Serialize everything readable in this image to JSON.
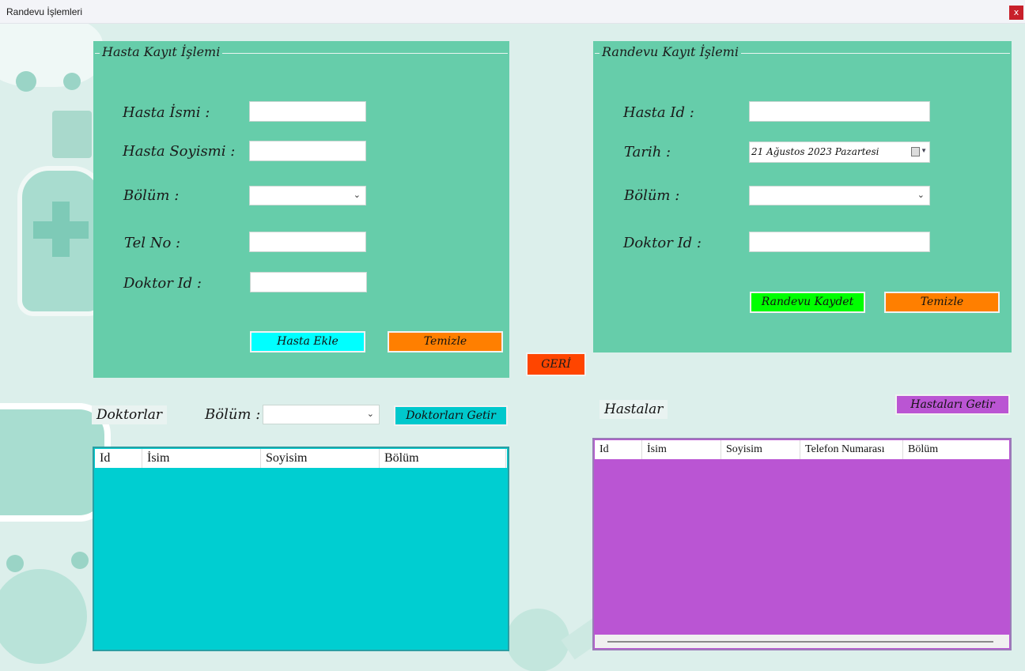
{
  "window": {
    "title": "Randevu İşlemleri",
    "close_label": "x"
  },
  "hasta_panel": {
    "title": "Hasta Kayıt İşlemi",
    "labels": {
      "isim": "Hasta İsmi :",
      "soyisim": "Hasta Soyismi :",
      "bolum": "Bölüm :",
      "tel": "Tel No :",
      "doktor": "Doktor Id :"
    },
    "values": {
      "isim": "",
      "soyisim": "",
      "bolum": "",
      "tel": "",
      "doktor": ""
    },
    "ekle_label": "Hasta Ekle",
    "temizle_label": "Temizle"
  },
  "randevu_panel": {
    "title": "Randevu Kayıt İşlemi",
    "labels": {
      "hasta_id": "Hasta Id :",
      "tarih": "Tarih :",
      "bolum": "Bölüm :",
      "doktor_id": "Doktor Id :"
    },
    "values": {
      "hasta_id": "",
      "tarih": "21 Ağustos 2023  Pazartesi",
      "bolum": "",
      "doktor_id": ""
    },
    "kaydet_label": "Randevu Kaydet",
    "temizle_label": "Temizle"
  },
  "geri_label": "GERİ",
  "doktorlar": {
    "title": "Doktorlar",
    "bolum_label": "Bölüm :",
    "bolum_value": "",
    "getir_label": "Doktorları Getir",
    "columns": [
      "Id",
      "İsim",
      "Soyisim",
      "Bölüm"
    ],
    "rows": []
  },
  "hastalar": {
    "title": "Hastalar",
    "getir_label": "Hastaları Getir",
    "columns": [
      "Id",
      "İsim",
      "Soyisim",
      "Telefon Numarası",
      "Bölüm"
    ],
    "rows": []
  },
  "colors": {
    "panel": "#66cdaa",
    "hasta_ekle_btn": "#00ffff",
    "temizle_btn": "#ff7f00",
    "kaydet_btn": "#00ff00",
    "geri_btn": "#ff4500",
    "doktor_grid": "#00ced1",
    "hasta_grid": "#ba55d3",
    "doktor_getir_btn": "#00c8cc",
    "hasta_getir_btn": "#ba55d3"
  }
}
